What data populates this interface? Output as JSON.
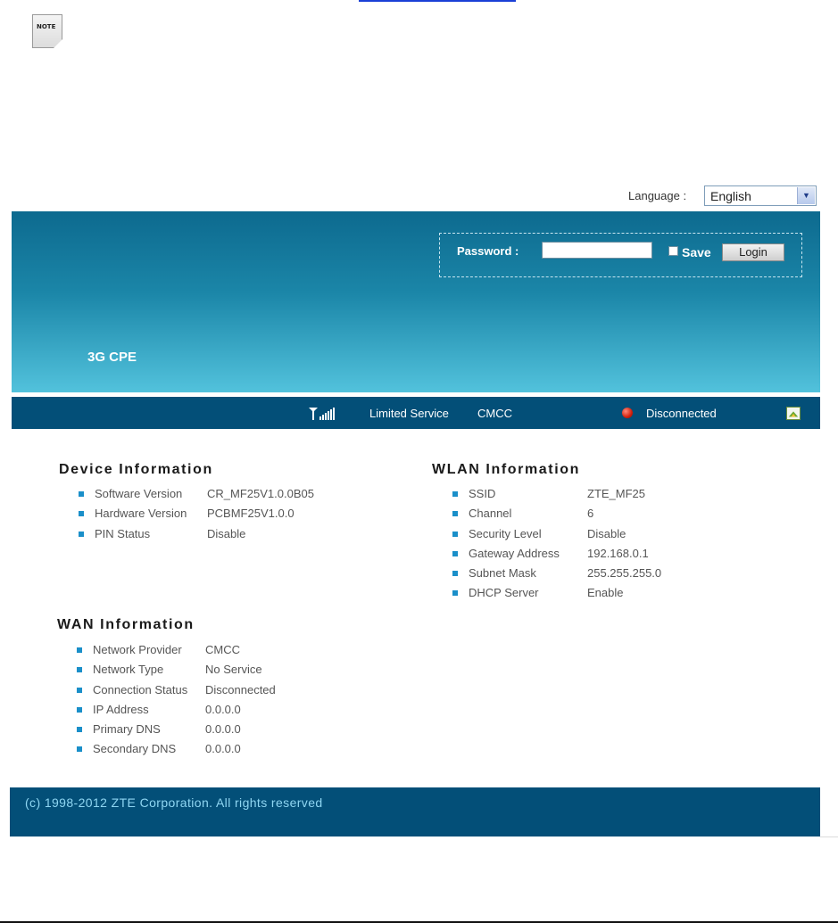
{
  "note_icon": {
    "label": "NOTE"
  },
  "language": {
    "label": "Language :",
    "selected": "English"
  },
  "login": {
    "password_label": "Password :",
    "password_value": "",
    "save_label": "Save",
    "login_label": "Login"
  },
  "product": {
    "name": "3G CPE"
  },
  "status_bar": {
    "service": "Limited Service",
    "provider": "CMCC",
    "connection": "Disconnected",
    "colors": {
      "bar": "#034f78",
      "disconnected": "#d2200d"
    }
  },
  "device_info": {
    "title": "Device Information",
    "items": [
      {
        "key": "Software Version",
        "value": "CR_MF25V1.0.0B05"
      },
      {
        "key": "Hardware Version",
        "value": "PCBMF25V1.0.0"
      },
      {
        "key": "PIN Status",
        "value": "Disable"
      }
    ]
  },
  "wlan_info": {
    "title": "WLAN Information",
    "items": [
      {
        "key": "SSID",
        "value": "ZTE_MF25"
      },
      {
        "key": "Channel",
        "value": "6"
      },
      {
        "key": "Security Level",
        "value": "Disable"
      },
      {
        "key": "Gateway Address",
        "value": "192.168.0.1"
      },
      {
        "key": "Subnet Mask",
        "value": "255.255.255.0"
      },
      {
        "key": "DHCP Server",
        "value": "Enable"
      }
    ]
  },
  "wan_info": {
    "title": "WAN Information",
    "items": [
      {
        "key": "Network Provider",
        "value": "CMCC"
      },
      {
        "key": "Network Type",
        "value": "No Service"
      },
      {
        "key": "Connection Status",
        "value": "Disconnected"
      },
      {
        "key": "IP Address",
        "value": "0.0.0.0"
      },
      {
        "key": "Primary DNS",
        "value": "0.0.0.0"
      },
      {
        "key": "Secondary DNS",
        "value": "0.0.0.0"
      }
    ]
  },
  "footer": {
    "copyright": "(c) 1998-2012 ZTE Corporation. All rights reserved"
  }
}
